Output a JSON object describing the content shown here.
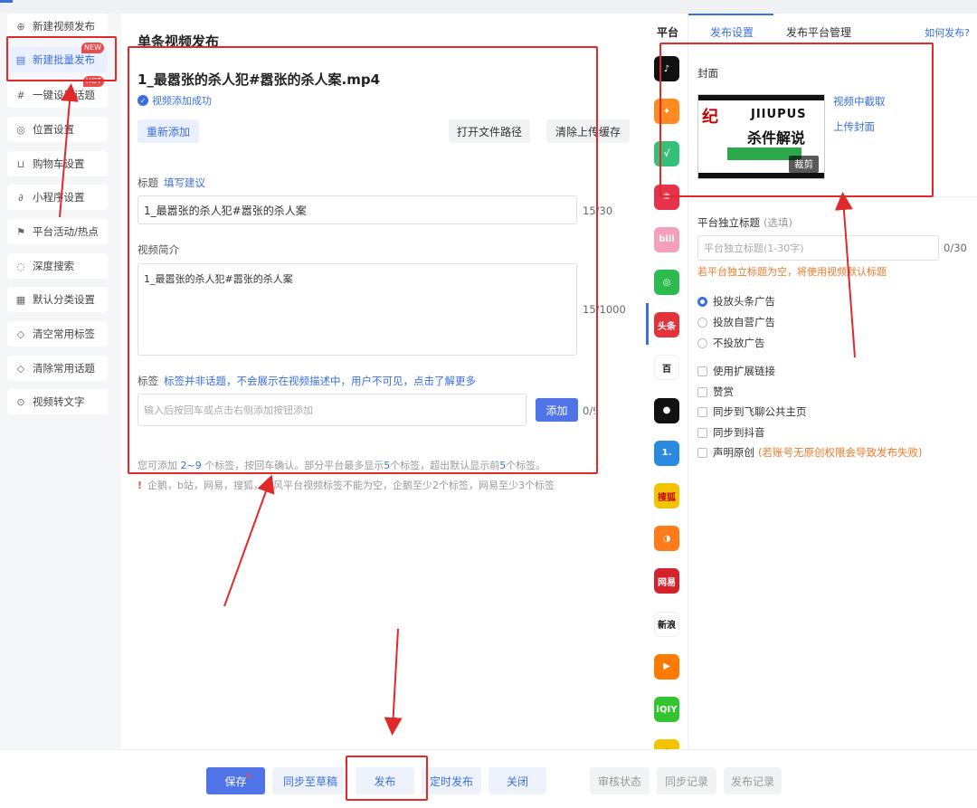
{
  "sidebar": {
    "items": [
      {
        "label": "新建视频发布",
        "icon": "video-add-icon",
        "glyph": "⊕"
      },
      {
        "label": "新建批量发布",
        "icon": "batch-icon",
        "glyph": "▤",
        "badge": "NEW"
      },
      {
        "label": "一键设置话题",
        "icon": "hashtag-icon",
        "glyph": "#",
        "badge": "HOT"
      },
      {
        "label": "位置设置",
        "icon": "location-icon",
        "glyph": "◎"
      },
      {
        "label": "购物车设置",
        "icon": "cart-icon",
        "glyph": "⊔"
      },
      {
        "label": "小程序设置",
        "icon": "mini-program-icon",
        "glyph": "∂"
      },
      {
        "label": "平台活动/热点",
        "icon": "flag-icon",
        "glyph": "⚑"
      },
      {
        "label": "深度搜索",
        "icon": "deep-search-icon",
        "glyph": "◌"
      },
      {
        "label": "默认分类设置",
        "icon": "category-icon",
        "glyph": "▦"
      },
      {
        "label": "清空常用标签",
        "icon": "tag-clear-icon",
        "glyph": "◇"
      },
      {
        "label": "清除常用话题",
        "icon": "topic-clear-icon",
        "glyph": "◇"
      },
      {
        "label": "视频转文字",
        "icon": "video-to-text-icon",
        "glyph": "⊙"
      }
    ]
  },
  "main": {
    "page_title": "单条视频发布",
    "file_name": "1_最嚣张的杀人犯#嚣张的杀人案.mp4",
    "upload_status": "视频添加成功",
    "buttons": {
      "readd": "重新添加",
      "open_path": "打开文件路径",
      "clear_cache": "清除上传缓存"
    },
    "title_label": "标题",
    "title_suggest": "填写建议",
    "title_value": "1_最嚣张的杀人犯#嚣张的杀人案",
    "title_count": "15/30",
    "desc_label": "视频简介",
    "desc_value": "1_最嚣张的杀人犯#嚣张的杀人案",
    "desc_count": "15/1000",
    "tag_label": "标签",
    "tag_hint": "标签并非话题，不会展示在视频描述中，用户不可见，点击了解更多",
    "tag_placeholder": "输入后按回车或点击右侧添加按钮添加",
    "tag_add": "添加",
    "tag_count": "0/9",
    "tag_rule": {
      "p1": "您可添加 ",
      "range": "2~9",
      "p2": " 个标签，按回车确认。部分平台最多显示",
      "n1": "5",
      "p3": "个标签，超出默认显示前",
      "n2": "5",
      "p4": "个标签。"
    },
    "warning": "企鹅，b站，网易，搜狐，大风平台视频标签不能为空，企鹅至少2个标签，网易至少3个标签"
  },
  "platforms": {
    "header": "平台",
    "items": [
      {
        "name": "douyin-icon",
        "color": "#111111",
        "glyph": "♪"
      },
      {
        "name": "kuaishou-icon",
        "color": "#ff8a1f",
        "glyph": "✦"
      },
      {
        "name": "shipinhao-green-icon",
        "color": "#35c07a",
        "glyph": "√"
      },
      {
        "name": "red-platform-icon",
        "color": "#e8314b",
        "glyph": "❀"
      },
      {
        "name": "bilibili-icon",
        "color": "#f3a0b8",
        "glyph": "bili"
      },
      {
        "name": "wechat-icon",
        "color": "#2dbb50",
        "glyph": "◎"
      },
      {
        "name": "toutiao-icon",
        "color": "#e3323a",
        "glyph": "头条"
      },
      {
        "name": "baijiahao-icon",
        "color": "#ffffff",
        "glyph": "百"
      },
      {
        "name": "qq-penguin-icon",
        "color": "#111111",
        "glyph": "●"
      },
      {
        "name": "yidian-icon",
        "color": "#2a8ae0",
        "glyph": "1."
      },
      {
        "name": "sohu-icon",
        "color": "#f5c400",
        "glyph": "搜狐"
      },
      {
        "name": "dafeng-icon",
        "color": "#ff7b1a",
        "glyph": "◑"
      },
      {
        "name": "netease-icon",
        "color": "#d2222a",
        "glyph": "网易"
      },
      {
        "name": "sina-kandian-icon",
        "color": "#ffffff",
        "glyph": "新浪"
      },
      {
        "name": "orange-platform-icon",
        "color": "#ff7a00",
        "glyph": "▶"
      },
      {
        "name": "iqiyi-icon",
        "color": "#32c530",
        "glyph": "iQIY"
      },
      {
        "name": "yellow-platform-icon",
        "color": "#f5c400",
        "glyph": "●"
      }
    ]
  },
  "settings": {
    "tabs": [
      "发布设置",
      "发布平台管理"
    ],
    "help": "如何发布?",
    "cover_label": "封面",
    "cover_art": {
      "brand_a": "纪",
      "brand_b": "JIIUPUS",
      "brand_c": "杀件解说"
    },
    "cover_crop": "裁剪",
    "cover_from_video": "视频中截取",
    "cover_upload": "上传封面",
    "platform_title_label": "平台独立标题",
    "platform_title_optional": "(选填)",
    "platform_title_placeholder": "平台独立标题(1-30字)",
    "platform_title_count": "0/30",
    "platform_title_note": "若平台独立标题为空，将使用视频默认标题",
    "ad_options": [
      "投放头条广告",
      "投放自营广告",
      "不投放广告"
    ],
    "checks": [
      "使用扩展链接",
      "赞赏",
      "同步到飞聊公共主页",
      "同步到抖音",
      "声明原创"
    ],
    "original_warning": "(若账号无原创权限会导致发布失败)"
  },
  "footer": {
    "save": "保存",
    "sync_draft": "同步至草稿",
    "publish": "发布",
    "schedule": "定时发布",
    "close": "关闭",
    "review_status": "审核状态",
    "sync_log": "同步记录",
    "publish_log": "发布记录"
  },
  "colors": {
    "accent": "#3a6fe0",
    "annotation": "#e02a2a",
    "warning": "#f07a2b"
  }
}
